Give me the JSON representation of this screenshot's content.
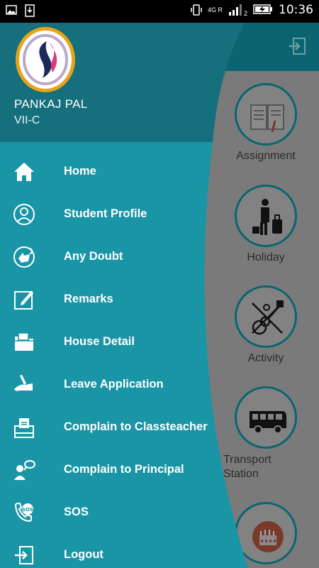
{
  "status_bar": {
    "network_label": "4G R",
    "signal_sub": "2",
    "time": "10:36"
  },
  "drawer": {
    "user_name": "PANKAJ PAL",
    "user_class": "VII-C",
    "items": [
      {
        "label": "Home",
        "icon": "home-icon"
      },
      {
        "label": "Student Profile",
        "icon": "user-profile-icon"
      },
      {
        "label": "Any Doubt",
        "icon": "doubt-icon"
      },
      {
        "label": "Remarks",
        "icon": "edit-icon"
      },
      {
        "label": "House Detail",
        "icon": "folder-icon"
      },
      {
        "label": "Leave Application",
        "icon": "writing-hand-icon"
      },
      {
        "label": "Complain to Classteacher",
        "icon": "ballot-box-icon"
      },
      {
        "label": "Complain to Principal",
        "icon": "speaking-person-icon"
      },
      {
        "label": "SOS",
        "icon": "sos-phone-icon"
      },
      {
        "label": "Logout",
        "icon": "logout-icon"
      }
    ]
  },
  "background": {
    "tiles": [
      {
        "label": "Assignment",
        "icon": "book-icon"
      },
      {
        "label": "Holiday",
        "icon": "traveler-icon"
      },
      {
        "label": "Activity",
        "icon": "guitar-icon"
      },
      {
        "label": "Transport\nStation",
        "icon": "bus-icon"
      },
      {
        "label": "",
        "icon": "cake-icon"
      }
    ]
  },
  "colors": {
    "drawer_header": "#156f7c",
    "drawer_body": "#1a95a6",
    "background_header": "#0b6570",
    "background_body": "#7a7a7a"
  }
}
